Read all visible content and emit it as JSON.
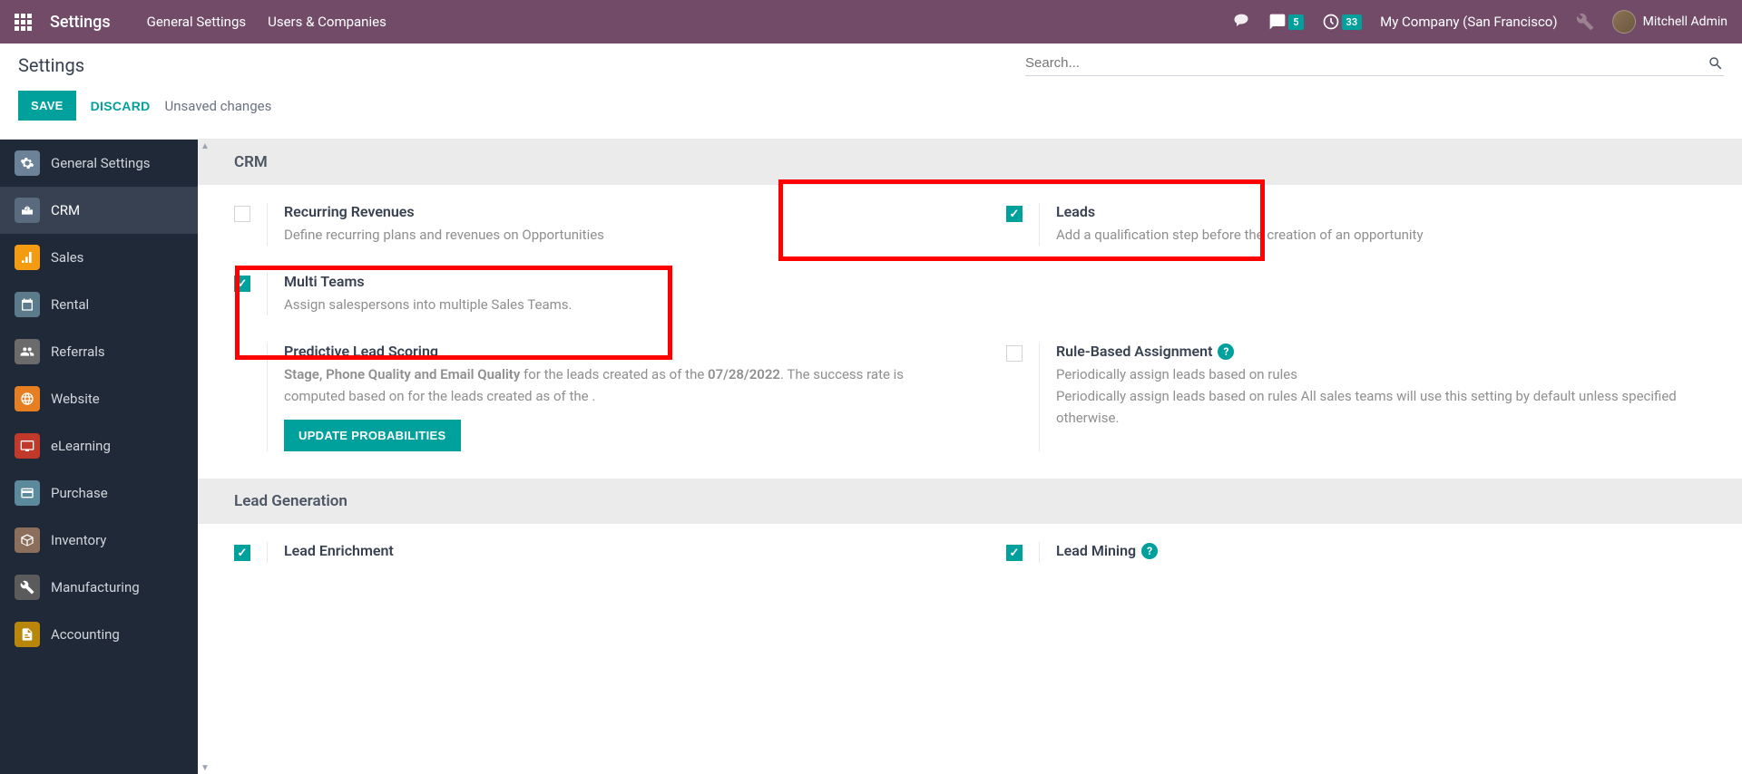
{
  "topbar": {
    "title": "Settings",
    "menu": [
      "General Settings",
      "Users & Companies"
    ],
    "messages_badge": "5",
    "activities_badge": "33",
    "company": "My Company (San Francisco)",
    "user": "Mitchell Admin"
  },
  "subheader": {
    "title": "Settings",
    "search_placeholder": "Search...",
    "save": "SAVE",
    "discard": "DISCARD",
    "unsaved": "Unsaved changes"
  },
  "sidebar": [
    {
      "label": "General Settings",
      "icon": "gear",
      "color": "#6b8299"
    },
    {
      "label": "CRM",
      "icon": "handshake",
      "color": "#5b6b7f",
      "active": true
    },
    {
      "label": "Sales",
      "icon": "chart",
      "color": "#f39c12"
    },
    {
      "label": "Rental",
      "icon": "calendar",
      "color": "#5b7a8c"
    },
    {
      "label": "Referrals",
      "icon": "people",
      "color": "#6b6b6b"
    },
    {
      "label": "Website",
      "icon": "globe",
      "color": "#e67e22"
    },
    {
      "label": "eLearning",
      "icon": "screen",
      "color": "#c0392b"
    },
    {
      "label": "Purchase",
      "icon": "card",
      "color": "#5b8a9c"
    },
    {
      "label": "Inventory",
      "icon": "box",
      "color": "#8b6f5c"
    },
    {
      "label": "Manufacturing",
      "icon": "wrench",
      "color": "#5b5b5b"
    },
    {
      "label": "Accounting",
      "icon": "doc",
      "color": "#b8860b"
    }
  ],
  "sections": {
    "crm": {
      "title": "CRM",
      "items": {
        "recurring": {
          "title": "Recurring Revenues",
          "desc": "Define recurring plans and revenues on Opportunities",
          "checked": false
        },
        "leads": {
          "title": "Leads",
          "desc": "Add a qualification step before the creation of an opportunity",
          "checked": true
        },
        "multiteams": {
          "title": "Multi Teams",
          "desc": "Assign salespersons into multiple Sales Teams.",
          "checked": true
        },
        "predictive": {
          "title": "Predictive Lead Scoring",
          "desc_bold": "Stage, Phone Quality and Email Quality",
          "desc_mid": " for the leads created as of the ",
          "desc_date": "07/28/2022",
          "desc_after": ". The success rate is computed based on for the leads created as of the .",
          "button": "UPDATE PROBABILITIES"
        },
        "rulebased": {
          "title": "Rule-Based Assignment",
          "desc": "Periodically assign leads based on rules\nPeriodically assign leads based on rules All sales teams will use this setting by default unless specified otherwise.",
          "checked": false
        }
      }
    },
    "leadgen": {
      "title": "Lead Generation",
      "items": {
        "enrichment": {
          "title": "Lead Enrichment",
          "checked": true
        },
        "mining": {
          "title": "Lead Mining",
          "checked": true
        }
      }
    }
  }
}
